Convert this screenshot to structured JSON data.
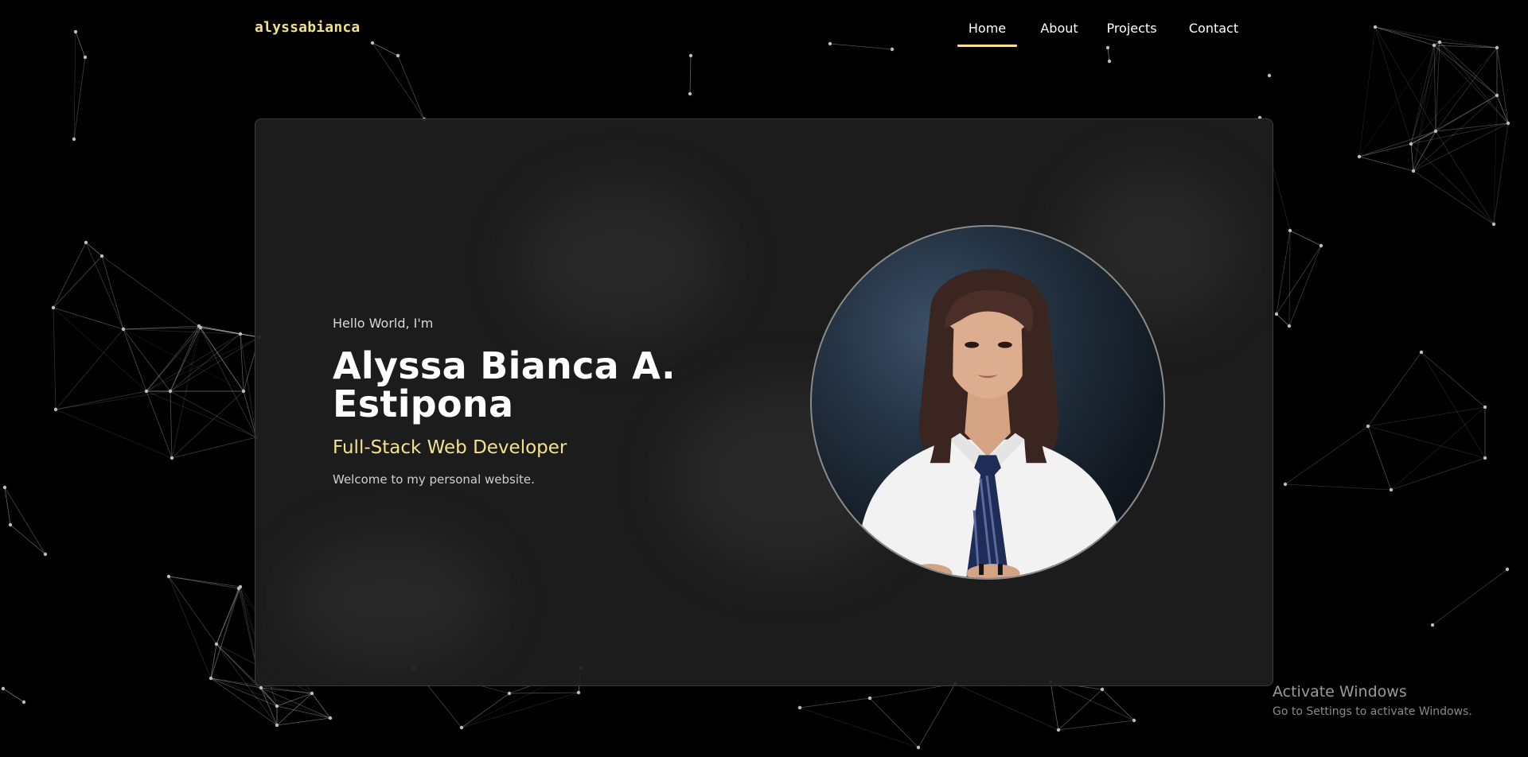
{
  "site": {
    "logo": "alyssabianca"
  },
  "nav": {
    "items": [
      {
        "label": "Home",
        "active": true
      },
      {
        "label": "About",
        "active": false
      },
      {
        "label": "Projects",
        "active": false
      },
      {
        "label": "Contact",
        "active": false
      }
    ]
  },
  "hero": {
    "greeting": "Hello World, I'm",
    "name_line1": "Alyssa Bianca A.",
    "name_line2": "Estipona",
    "role": "Full-Stack Web Developer",
    "welcome": "Welcome to my personal website."
  },
  "watermark": {
    "title": "Activate Windows",
    "subtitle": "Go to Settings to activate Windows."
  },
  "colors": {
    "accent": "#f3e28b",
    "background": "#000000",
    "card": "#1e1e1e"
  }
}
